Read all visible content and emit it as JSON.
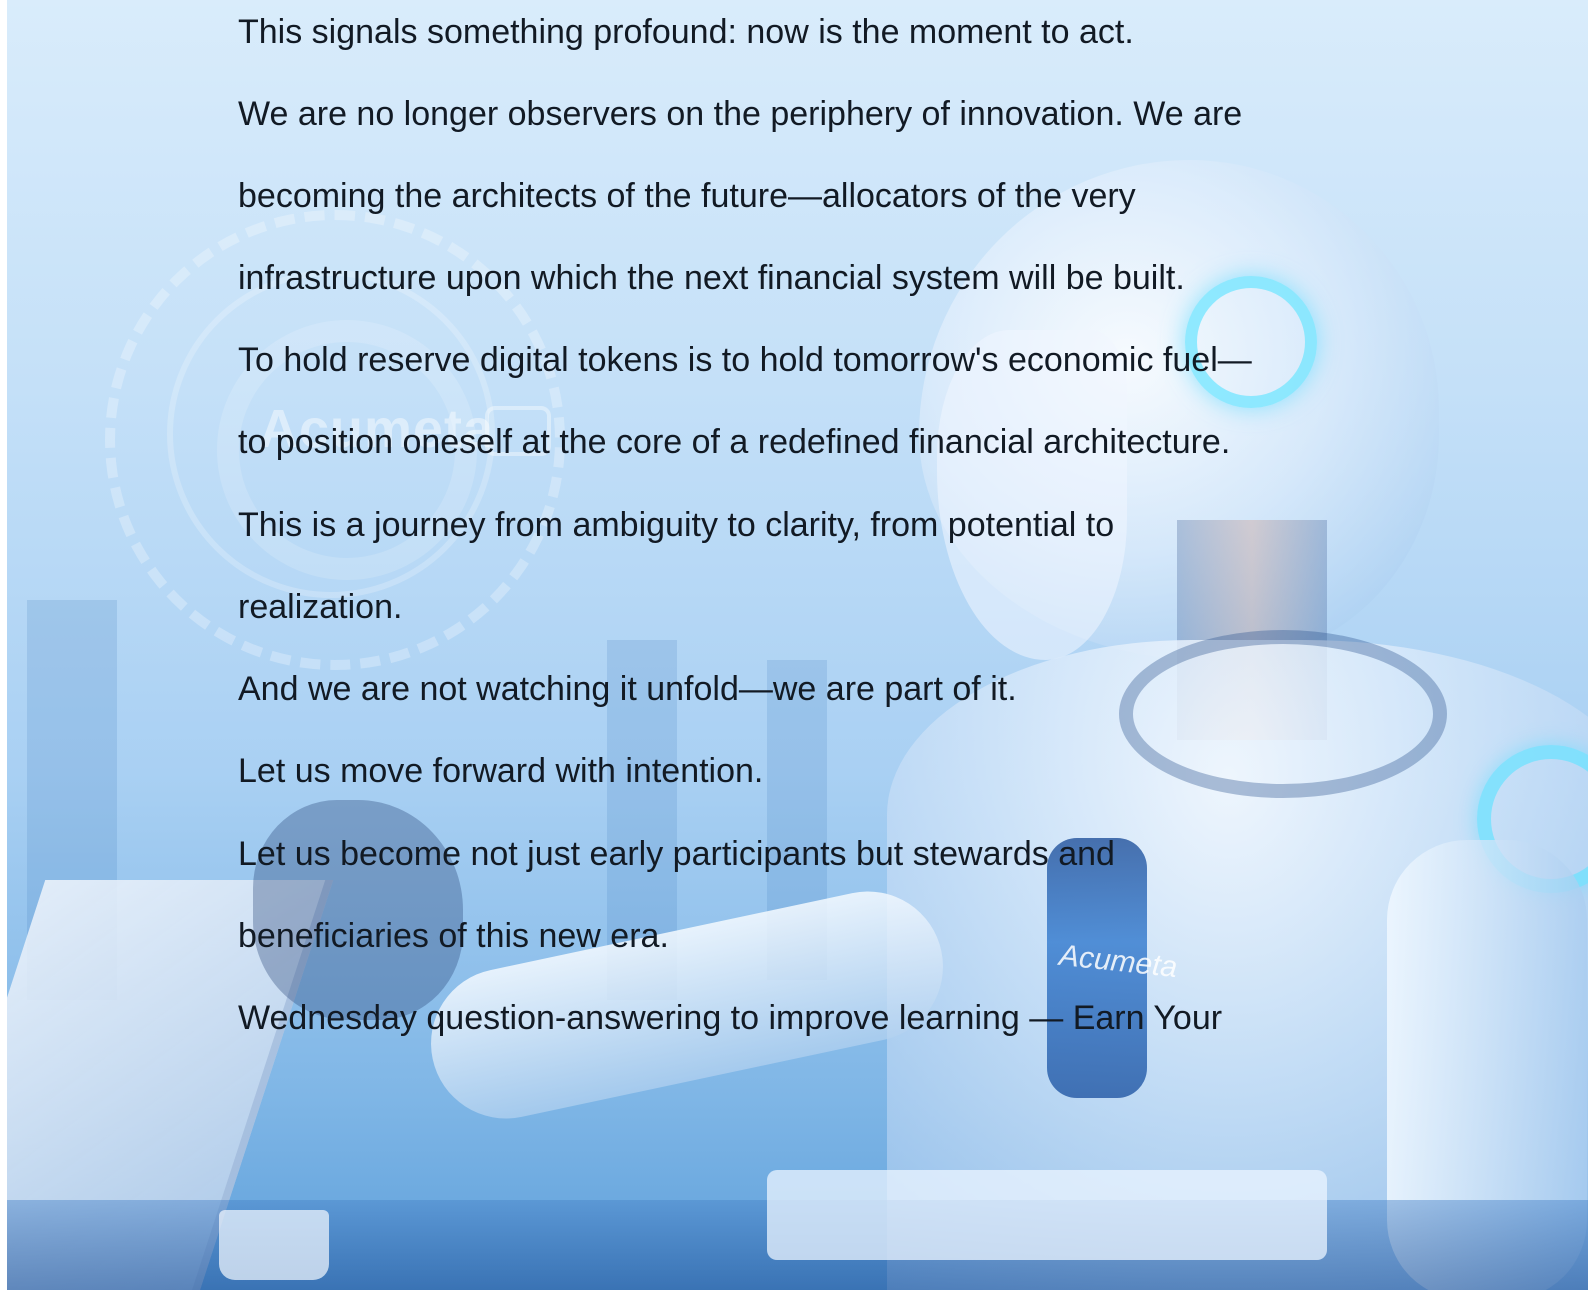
{
  "document": {
    "lines": [
      "This signals something profound: now is the moment to act.",
      "We are no longer observers on the periphery of innovation. We are",
      "becoming the architects of the future—allocators of the very",
      "infrastructure upon which the next financial system will be built.",
      "To hold reserve digital tokens is to hold tomorrow's economic fuel—",
      "to position oneself at the core of a redefined financial architecture.",
      "This is a journey from ambiguity to clarity, from potential to",
      "realization.",
      "And we are not watching it unfold—we are part of it.",
      "Let us move forward with intention.",
      "Let us become not just early participants but stewards and",
      "beneficiaries of this new era.",
      "Wednesday question-answering to improve learning — Earn Your"
    ]
  },
  "background": {
    "watermark_logo": "Acumeta",
    "chest_logo": "Acumeta",
    "colors": {
      "text": "#121a24",
      "sky_top": "#d9ecfb",
      "sky_bottom": "#5d9fda",
      "accent_glow": "#78e6ff"
    }
  }
}
